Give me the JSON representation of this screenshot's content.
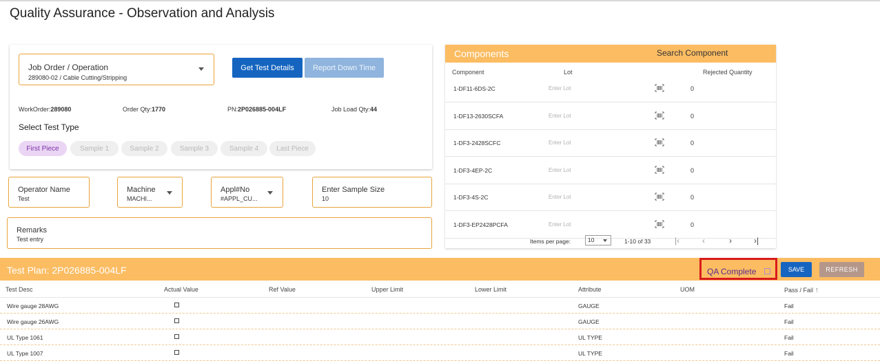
{
  "page": {
    "title": "Quality Assurance - Observation and Analysis"
  },
  "job": {
    "label": "Job Order / Operation",
    "value": "289080-02 / Cable Cutting/Stripping",
    "get_test_details": "Get Test Details",
    "report_down_time": "Report Down Time",
    "workorder_label": "WorkOrder:",
    "workorder_value": "289080",
    "order_qty_label": "Order Qty:",
    "order_qty_value": "1770",
    "pn_label": "PN:",
    "pn_value": "2P026885-004LF",
    "job_load_label": "Job Load Qty:",
    "job_load_value": "44",
    "select_test_type": "Select Test Type",
    "chips": [
      "First Piece",
      "Sample 1",
      "Sample 2",
      "Sample 3",
      "Sample 4",
      "Last Piece"
    ]
  },
  "form": {
    "operator_label": "Operator Name",
    "operator_value": "Test",
    "machine_label": "Machine",
    "machine_value": "MACHI...",
    "appl_label": "Appl#No",
    "appl_value": "#APPL_CU...",
    "sample_label": "Enter Sample Size",
    "sample_value": "10",
    "remarks_label": "Remarks",
    "remarks_value": "Test entry"
  },
  "components": {
    "title": "Components",
    "search": "Search Component",
    "headers": {
      "component": "Component",
      "lot": "Lot",
      "rejected": "Rejected Quantity"
    },
    "lot_placeholder": "Enter Lot",
    "rows": [
      {
        "name": "1-DF11-6DS-2C",
        "qty": "0"
      },
      {
        "name": "1-DF13-2630SCFA",
        "qty": "0"
      },
      {
        "name": "1-DF3-2428SCFC",
        "qty": "0"
      },
      {
        "name": "1-DF3-4EP-2C",
        "qty": "0"
      },
      {
        "name": "1-DF3-4S-2C",
        "qty": "0"
      },
      {
        "name": "1-DF3-EP2428PCFA",
        "qty": "0"
      }
    ],
    "pager": {
      "items_per_page": "Items per page:",
      "page_size": "10",
      "range": "1-10 of 33"
    }
  },
  "plan": {
    "title": "Test Plan: 2P026885-004LF",
    "qa_complete": "QA Complete",
    "save": "SAVE",
    "refresh": "REFRESH",
    "headers": {
      "desc": "Test Desc",
      "actual": "Actual Value",
      "ref": "Ref Value",
      "upper": "Upper Limit",
      "lower": "Lower Limit",
      "attribute": "Attribute",
      "uom": "UOM",
      "pass": "Pass / Fail"
    },
    "rows": [
      {
        "desc": "Wire gauge 28AWG",
        "attribute": "GAUGE",
        "pass": "Fail"
      },
      {
        "desc": "Wire gauge 26AWG",
        "attribute": "GAUGE",
        "pass": "Fail"
      },
      {
        "desc": "UL Type 1061",
        "attribute": "UL TYPE",
        "pass": "Fail"
      },
      {
        "desc": "UL Type 1007",
        "attribute": "UL TYPE",
        "pass": "Fail"
      }
    ]
  },
  "colors": {
    "accent": "#fbbc62",
    "primary": "#1565c0",
    "field_border": "#e8a33a",
    "highlight": "#d81b1b"
  }
}
